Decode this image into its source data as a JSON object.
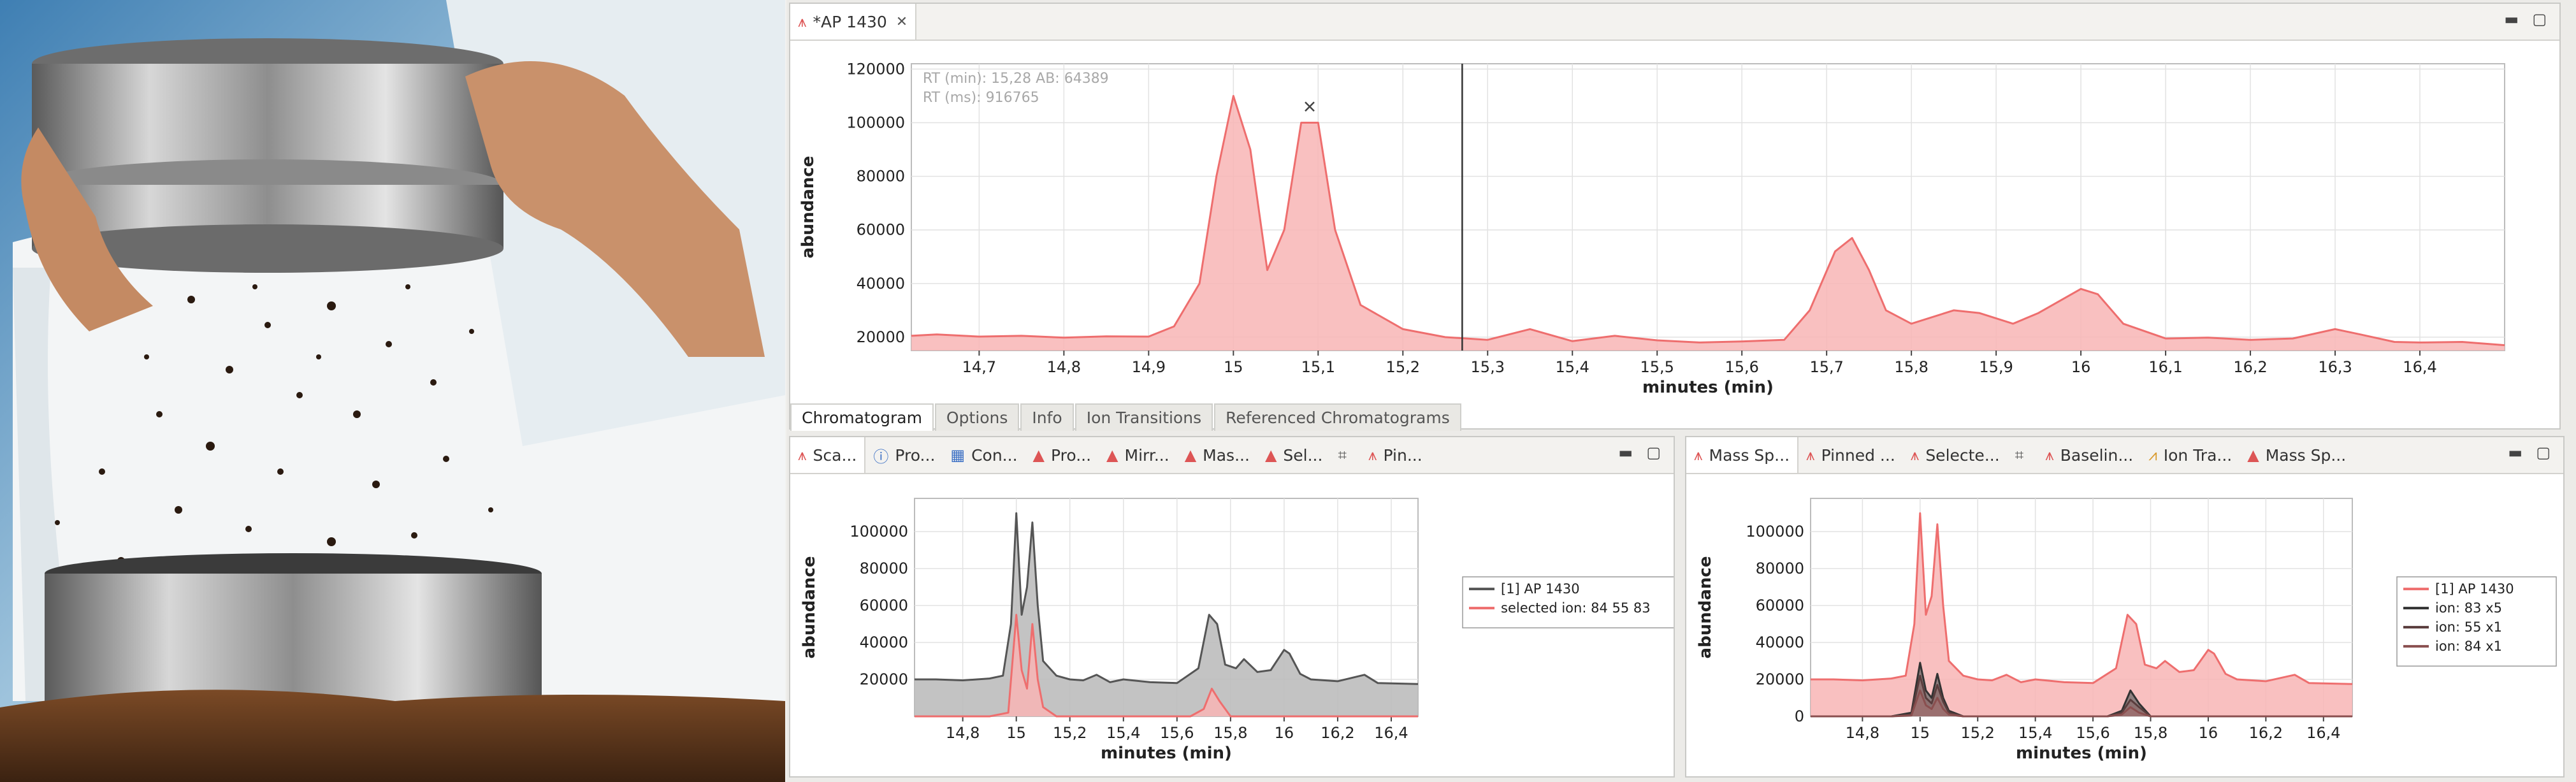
{
  "editor": {
    "title": "*AP 1430",
    "tabs": [
      "Chromatogram",
      "Options",
      "Info",
      "Ion Transitions",
      "Referenced Chromatograms"
    ],
    "active_tab": "Chromatogram"
  },
  "left_panel": {
    "tabs": [
      "Sca...",
      "Pro...",
      "Con...",
      "Pro...",
      "Mirr...",
      "Mas...",
      "Sel...",
      "Pin..."
    ]
  },
  "right_panel": {
    "tabs": [
      "Mass Sp...",
      "Pinned ...",
      "Selecte...",
      "Baselin...",
      "Ion Tra...",
      "Mass Sp..."
    ]
  },
  "colors": {
    "red": "#ee6e6e",
    "red_fill": "#f8b5b5",
    "gray": "#555555",
    "gray_fill": "#bdbdbd"
  },
  "icons": [
    "chromatogram-icon",
    "minimize-icon",
    "maximize-icon",
    "close-icon"
  ],
  "chart_data": [
    {
      "type": "area",
      "panel": "main",
      "xlabel": "minutes (min)",
      "ylabel": "abundance",
      "xlim": [
        14.62,
        16.5
      ],
      "ylim": [
        15000,
        122000
      ],
      "xticks": [
        "14,7",
        "14,8",
        "14,9",
        "15",
        "15,1",
        "15,2",
        "15,3",
        "15,4",
        "15,5",
        "15,6",
        "15,7",
        "15,8",
        "15,9",
        "16",
        "16,1",
        "16,2",
        "16,3",
        "16,4"
      ],
      "yticks": [
        "20000",
        "40000",
        "60000",
        "80000",
        "100000",
        "120000"
      ],
      "cursor_x": 15.27,
      "peak_marker_x": 15.09,
      "annotations": [
        "RT (min): 15,28 AB: 64389",
        "RT (ms): 916765"
      ],
      "series": [
        {
          "x": [
            14.62,
            14.65,
            14.7,
            14.75,
            14.8,
            14.85,
            14.9,
            14.93,
            14.96,
            14.98,
            15.0,
            15.02,
            15.04,
            15.06,
            15.08,
            15.1,
            15.12,
            15.15,
            15.2,
            15.25,
            15.3,
            15.35,
            15.4,
            15.45,
            15.5,
            15.55,
            15.6,
            15.65,
            15.68,
            15.71,
            15.73,
            15.75,
            15.77,
            15.8,
            15.85,
            15.88,
            15.92,
            15.95,
            16.0,
            16.02,
            16.05,
            16.1,
            16.15,
            16.2,
            16.25,
            16.3,
            16.33,
            16.37,
            16.4,
            16.45,
            16.5
          ],
          "values": [
            20500,
            21000,
            20200,
            20500,
            19800,
            20300,
            20200,
            24000,
            40000,
            80000,
            110000,
            90000,
            45000,
            60000,
            100000,
            100000,
            60000,
            32000,
            23000,
            20000,
            19000,
            23000,
            18500,
            20500,
            18800,
            18000,
            18400,
            19000,
            30000,
            52000,
            57000,
            45000,
            30000,
            25000,
            30000,
            29000,
            25000,
            29000,
            38000,
            36000,
            25000,
            19500,
            19800,
            19000,
            19500,
            23000,
            21000,
            18200,
            18000,
            18200,
            17000
          ]
        }
      ]
    },
    {
      "type": "area",
      "panel": "bottom-left",
      "xlabel": "minutes (min)",
      "ylabel": "abundance",
      "xlim": [
        14.62,
        16.5
      ],
      "ylim": [
        0,
        118000
      ],
      "xticks": [
        "14,8",
        "15",
        "15,2",
        "15,4",
        "15,6",
        "15,8",
        "16",
        "16,2",
        "16,4"
      ],
      "yticks": [
        "20000",
        "40000",
        "60000",
        "80000",
        "100000"
      ],
      "series": [
        {
          "name": "[1] AP 1430",
          "x": [
            14.62,
            14.7,
            14.8,
            14.9,
            14.95,
            14.98,
            15.0,
            15.02,
            15.04,
            15.06,
            15.08,
            15.1,
            15.15,
            15.2,
            15.25,
            15.3,
            15.35,
            15.4,
            15.5,
            15.6,
            15.68,
            15.72,
            15.75,
            15.78,
            15.82,
            15.85,
            15.9,
            15.95,
            16.0,
            16.02,
            16.06,
            16.1,
            16.2,
            16.3,
            16.35,
            16.5
          ],
          "values": [
            20000,
            20000,
            19500,
            20500,
            22000,
            50000,
            110000,
            55000,
            70000,
            105000,
            60000,
            30000,
            22000,
            20000,
            19500,
            22500,
            18500,
            20000,
            18500,
            18000,
            26000,
            55000,
            50000,
            28000,
            26000,
            31000,
            24000,
            25000,
            36000,
            34000,
            23000,
            20000,
            19000,
            22500,
            18000,
            17500
          ]
        },
        {
          "name": "selected ion: 84 55 83",
          "x": [
            14.62,
            14.9,
            14.97,
            15.0,
            15.02,
            15.04,
            15.06,
            15.08,
            15.1,
            15.15,
            15.3,
            15.65,
            15.7,
            15.73,
            15.76,
            15.8,
            16.0,
            16.5
          ],
          "values": [
            0,
            0,
            2000,
            55000,
            25000,
            15000,
            50000,
            20000,
            5000,
            0,
            0,
            0,
            4000,
            15000,
            8000,
            0,
            0,
            0
          ]
        }
      ]
    },
    {
      "type": "area",
      "panel": "bottom-right",
      "xlabel": "minutes (min)",
      "ylabel": "abundance",
      "xlim": [
        14.62,
        16.5
      ],
      "ylim": [
        0,
        118000
      ],
      "xticks": [
        "14,8",
        "15",
        "15,2",
        "15,4",
        "15,6",
        "15,8",
        "16",
        "16,2",
        "16,4"
      ],
      "yticks": [
        "0",
        "20000",
        "40000",
        "60000",
        "80000",
        "100000"
      ],
      "series": [
        {
          "name": "[1] AP 1430",
          "x": [
            14.62,
            14.7,
            14.8,
            14.9,
            14.95,
            14.98,
            15.0,
            15.02,
            15.04,
            15.06,
            15.08,
            15.1,
            15.15,
            15.2,
            15.25,
            15.3,
            15.35,
            15.4,
            15.5,
            15.6,
            15.68,
            15.72,
            15.75,
            15.78,
            15.82,
            15.85,
            15.9,
            15.95,
            16.0,
            16.02,
            16.06,
            16.1,
            16.2,
            16.3,
            16.35,
            16.5
          ],
          "values": [
            20000,
            20000,
            19500,
            20500,
            22000,
            50000,
            110000,
            55000,
            65000,
            104000,
            60000,
            30000,
            22000,
            20000,
            19500,
            22500,
            18500,
            20000,
            18500,
            18000,
            26000,
            55000,
            50000,
            28000,
            26000,
            30000,
            24000,
            25000,
            36000,
            34000,
            23000,
            20000,
            19000,
            22500,
            18000,
            17500
          ]
        },
        {
          "name": "ion: 83 x5",
          "x": [
            14.62,
            14.9,
            14.97,
            15.0,
            15.02,
            15.04,
            15.06,
            15.08,
            15.1,
            15.15,
            15.3,
            15.65,
            15.7,
            15.73,
            15.76,
            15.8,
            16.0,
            16.5
          ],
          "values": [
            0,
            0,
            2000,
            29000,
            14000,
            10000,
            23000,
            10000,
            3000,
            0,
            0,
            0,
            3000,
            14000,
            7000,
            0,
            0,
            0
          ]
        },
        {
          "name": "ion: 55 x1",
          "x": [
            14.62,
            14.9,
            14.97,
            15.0,
            15.02,
            15.04,
            15.06,
            15.08,
            15.1,
            15.15,
            15.3,
            15.65,
            15.7,
            15.73,
            15.76,
            15.8,
            16.0,
            16.5
          ],
          "values": [
            0,
            0,
            1000,
            22000,
            10000,
            7000,
            17000,
            8000,
            2000,
            0,
            0,
            0,
            2000,
            9000,
            5000,
            0,
            0,
            0
          ]
        },
        {
          "name": "ion: 84 x1",
          "x": [
            14.62,
            14.9,
            14.97,
            15.0,
            15.02,
            15.04,
            15.06,
            15.08,
            15.1,
            15.15,
            15.3,
            15.65,
            15.7,
            15.73,
            15.76,
            15.8,
            16.0,
            16.5
          ],
          "values": [
            0,
            0,
            500,
            14000,
            6000,
            4000,
            10000,
            4000,
            1000,
            0,
            0,
            0,
            1000,
            5000,
            2000,
            0,
            0,
            0
          ]
        }
      ]
    }
  ]
}
